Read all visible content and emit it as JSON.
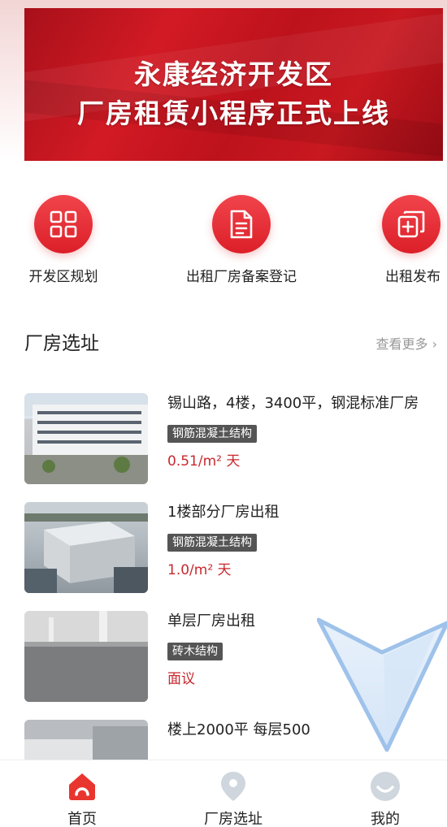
{
  "banner": {
    "line1": "永康经济开发区",
    "line2": "厂房租赁小程序正式上线"
  },
  "quick_entries": [
    {
      "label": "开发区规划",
      "icon": "grid-icon"
    },
    {
      "label": "出租厂房备案登记",
      "icon": "document-icon"
    },
    {
      "label": "出租发布",
      "icon": "add-doc-icon"
    }
  ],
  "section": {
    "title": "厂房选址",
    "more": "查看更多"
  },
  "listings": [
    {
      "title": "锡山路，4楼，3400平，钢混标准厂房",
      "tag": "钢筋混凝土结构",
      "price": "0.51/m² 天"
    },
    {
      "title": "1楼部分厂房出租",
      "tag": "钢筋混凝土结构",
      "price": "1.0/m² 天"
    },
    {
      "title": "单层厂房出租",
      "tag": "砖木结构",
      "price": "面议"
    },
    {
      "title": "楼上2000平 每层500"
    }
  ],
  "tabbar": [
    {
      "label": "首页",
      "icon": "home-icon",
      "active": true
    },
    {
      "label": "厂房选址",
      "icon": "location-pin-icon",
      "active": false
    },
    {
      "label": "我的",
      "icon": "profile-face-icon",
      "active": false
    }
  ],
  "colors": {
    "accent": "#dc1f28",
    "price": "#c8282e",
    "tag_bg": "#555555",
    "muted": "#999999"
  }
}
